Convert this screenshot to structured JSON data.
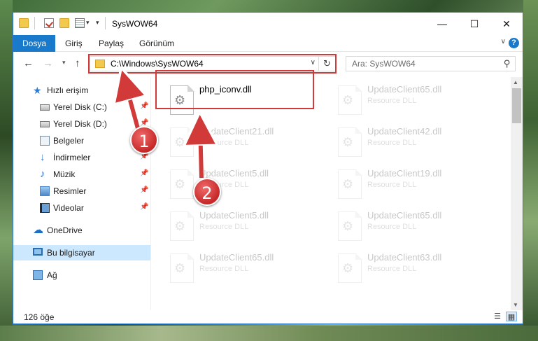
{
  "window": {
    "title": "SysWOW64"
  },
  "ribbon": {
    "tabs": [
      "Dosya",
      "Giriş",
      "Paylaş",
      "Görünüm"
    ]
  },
  "address": {
    "path": "C:\\Windows\\SysWOW64"
  },
  "search": {
    "placeholder": "Ara: SysWOW64"
  },
  "sidebar": {
    "items": [
      {
        "label": "Hızlı erişim",
        "icon": "star-icon"
      },
      {
        "label": "Yerel Disk (C:)",
        "icon": "disk-icon",
        "pinned": true
      },
      {
        "label": "Yerel Disk (D:)",
        "icon": "disk-icon",
        "pinned": true
      },
      {
        "label": "Belgeler",
        "icon": "documents-icon",
        "pinned": true
      },
      {
        "label": "İndirmeler",
        "icon": "download-icon",
        "pinned": true
      },
      {
        "label": "Müzik",
        "icon": "music-icon",
        "pinned": true
      },
      {
        "label": "Resimler",
        "icon": "pictures-icon",
        "pinned": true
      },
      {
        "label": "Videolar",
        "icon": "videos-icon",
        "pinned": true
      },
      {
        "label": "OneDrive",
        "icon": "cloud-icon"
      },
      {
        "label": "Bu bilgisayar",
        "icon": "computer-icon",
        "selected": true
      },
      {
        "label": "Ağ",
        "icon": "network-icon"
      }
    ]
  },
  "files": [
    {
      "name": "php_iconv.dll",
      "type": "",
      "highlighted": true
    },
    {
      "name": "UpdateClient65.dll",
      "type": "Resource DLL"
    },
    {
      "name": "UpdateClient21.dll",
      "type": "Resource DLL"
    },
    {
      "name": "UpdateClient42.dll",
      "type": "Resource DLL"
    },
    {
      "name": "UpdateClient5.dll",
      "type": "Resource DLL"
    },
    {
      "name": "UpdateClient19.dll",
      "type": "Resource DLL"
    },
    {
      "name": "UpdateClient5.dll",
      "type": "Resource DLL"
    },
    {
      "name": "UpdateClient65.dll",
      "type": "Resource DLL"
    },
    {
      "name": "UpdateClient65.dll",
      "type": "Resource DLL"
    },
    {
      "name": "UpdateClient63.dll",
      "type": "Resource DLL"
    }
  ],
  "status": {
    "count": "126 öğe"
  },
  "annotations": {
    "step1": "1",
    "step2": "2",
    "color": "#d23a3a"
  }
}
